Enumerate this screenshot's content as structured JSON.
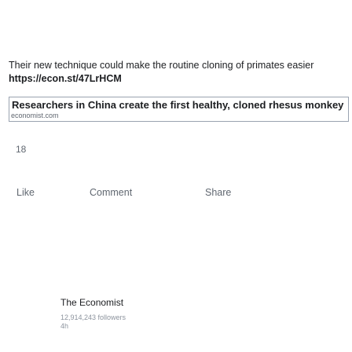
{
  "post": {
    "text": "Their new technique could make the routine cloning of primates easier",
    "link": "https://econ.st/47LrHCM"
  },
  "link_card": {
    "title": "Researchers in China create the first healthy, cloned rhesus monkey",
    "domain": "economist.com"
  },
  "reactions": {
    "count": "18"
  },
  "actions": {
    "like": "Like",
    "comment": "Comment",
    "share": "Share"
  },
  "author": {
    "name": "The Economist",
    "followers": "12,914,243 followers",
    "time": "4h"
  },
  "colors": {
    "text": "#1c1e21",
    "muted": "#606770",
    "card_border": "#9aa3b0"
  }
}
